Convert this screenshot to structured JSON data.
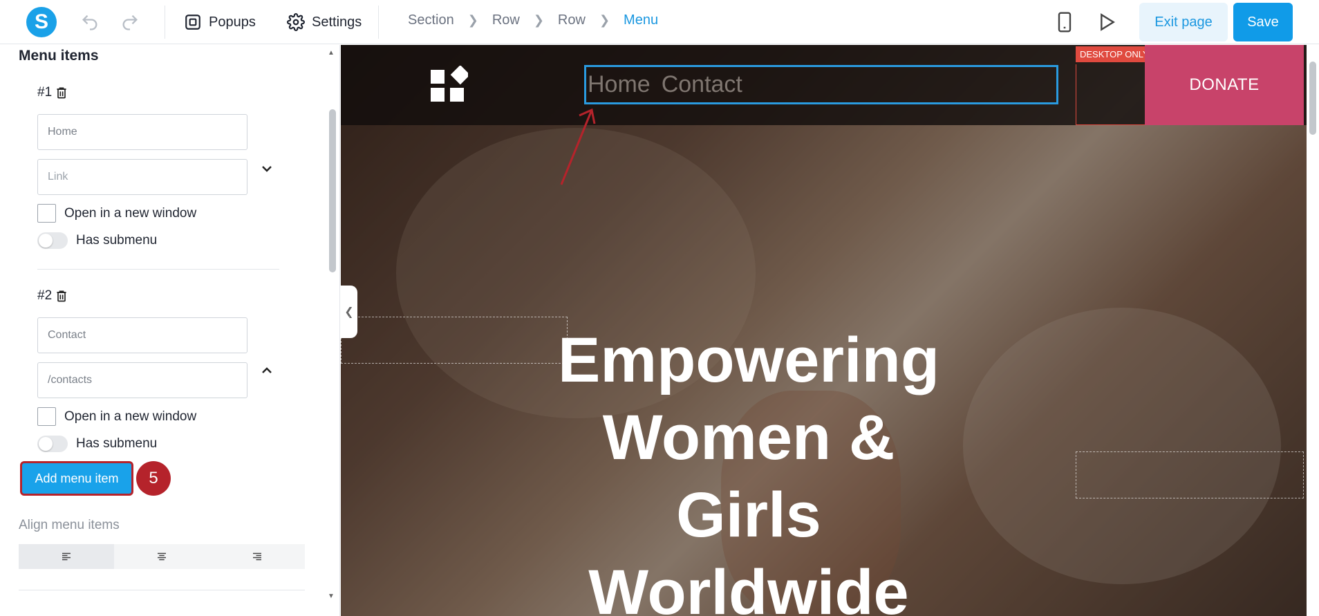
{
  "topbar": {
    "popups_label": "Popups",
    "settings_label": "Settings",
    "breadcrumb": [
      "Section",
      "Row",
      "Row",
      "Menu"
    ],
    "exit_label": "Exit page",
    "save_label": "Save"
  },
  "panel": {
    "title": "Menu items",
    "items": [
      {
        "number": "#1",
        "name_value": "Home",
        "link_placeholder": "Link",
        "open_new_window": "Open in a new window",
        "has_submenu": "Has submenu"
      },
      {
        "number": "#2",
        "name_value": "Contact",
        "link_value": "/contacts",
        "open_new_window": "Open in a new window",
        "has_submenu": "Has submenu"
      }
    ],
    "add_button": "Add menu item",
    "step_number": "5",
    "align_label": "Align menu items"
  },
  "canvas": {
    "menu_items": [
      "Home",
      "Contact"
    ],
    "desktop_only": "DESKTOP ONLY",
    "donate": "DONATE",
    "hero_lines": [
      "Empowering",
      "Women &",
      "Girls",
      "Worldwide"
    ]
  },
  "colors": {
    "accent": "#1aa1e8",
    "annotation": "#b5232b",
    "donate": "#c8436a"
  }
}
